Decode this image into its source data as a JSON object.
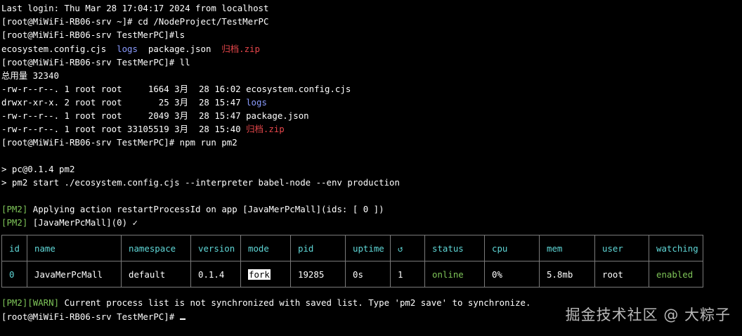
{
  "terminal": {
    "last_login": "Last login: Thu Mar 28 17:04:17 2024 from localhost",
    "cmd1": "[root@MiWiFi-RB06-srv ~]# cd /NodeProject/TestMerPC",
    "cmd2": "[root@MiWiFi-RB06-srv TestMerPC]#ls",
    "ls": {
      "file1": "ecosystem.config.cjs",
      "dir1": "logs",
      "file2": "package.json",
      "zip": "归档.zip"
    },
    "cmd3": "[root@MiWiFi-RB06-srv TestMerPC]# ll",
    "total": "总用量 32340",
    "ll_rows": [
      {
        "meta": "-rw-r--r--. 1 root root     1664 3月  28 16:02 ",
        "name": "ecosystem.config.cjs"
      },
      {
        "meta": "drwxr-xr-x. 2 root root       25 3月  28 15:47 ",
        "name": "logs"
      },
      {
        "meta": "-rw-r--r--. 1 root root     2049 3月  28 15:47 ",
        "name": "package.json"
      },
      {
        "meta": "-rw-r--r--. 1 root root 33105519 3月  28 15:40 ",
        "name": "归档.zip"
      }
    ],
    "cmd4": "[root@MiWiFi-RB06-srv TestMerPC]# npm run pm2",
    "npm1": "> pc@0.1.4 pm2",
    "npm2": "> pm2 start ./ecosystem.config.cjs --interpreter babel-node --env production",
    "pm2_tag": "[PM2]",
    "pm2_msg1": " Applying action restartProcessId on app [JavaMerPcMall](ids: [ 0 ])",
    "pm2_msg2": " [JavaMerPcMall](0) ✓",
    "warn_tag": "[PM2][WARN]",
    "warn_msg": " Current process list is not synchronized with saved list. Type 'pm2 save' to synchronize.",
    "prompt": "[root@MiWiFi-RB06-srv TestMerPC]# "
  },
  "table": {
    "headers": [
      "id",
      "name",
      "namespace",
      "version",
      "mode",
      "pid",
      "uptime",
      "↺",
      "status",
      "cpu",
      "mem",
      "user",
      "watching"
    ],
    "row": {
      "id": "0",
      "name": "JavaMerPcMall",
      "namespace": "default",
      "version": "0.1.4",
      "mode": "fork",
      "pid": "19285",
      "uptime": "0s",
      "restarts": "1",
      "status": "online",
      "cpu": "0%",
      "mem": "5.8mb",
      "user": "root",
      "watching": "enabled"
    }
  },
  "watermark": "掘金技术社区 @ 大粽子",
  "colors": {
    "dir": "#8b9cff",
    "archive": "#e8474b",
    "pm2_tag": "#7ec458",
    "table_header": "#5fd7d7",
    "background": "#000000"
  }
}
